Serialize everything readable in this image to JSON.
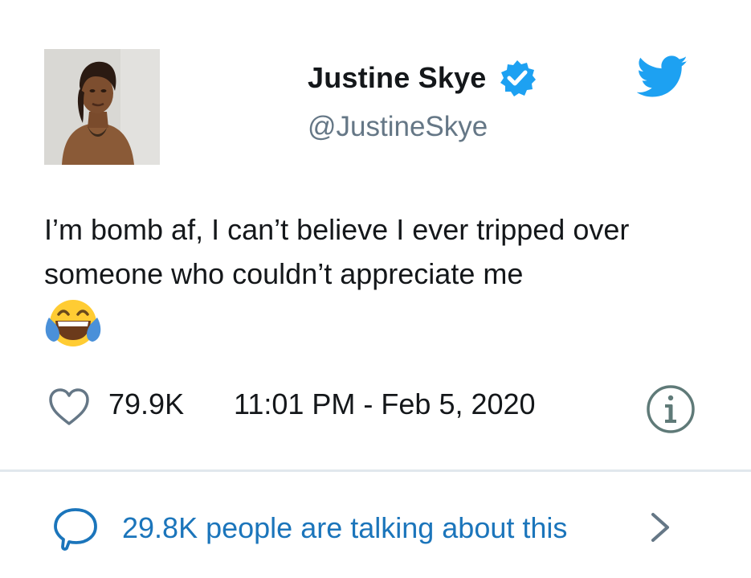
{
  "user": {
    "display_name": "Justine Skye",
    "handle": "@JustineSkye",
    "verified": true,
    "avatar_icon": "profile-photo"
  },
  "tweet": {
    "text": "I’m bomb af, I can’t believe I ever tripped over someone who couldn’t appreciate me",
    "emoji": "face-with-tears-of-joy"
  },
  "meta": {
    "like_count": "79.9K",
    "timestamp": "11:01 PM - Feb 5, 2020"
  },
  "engagement": {
    "talking_text": "29.8K people are talking about this"
  },
  "icons": {
    "brand": "twitter-bird-icon",
    "like": "heart-icon",
    "info": "info-icon",
    "reply": "speech-bubble-icon",
    "more": "chevron-right-icon"
  },
  "colors": {
    "brand_blue": "#1da1f2",
    "link_blue": "#1b75bb",
    "text_primary": "#14171a",
    "text_secondary": "#657786",
    "divider": "#e1e8ed"
  }
}
